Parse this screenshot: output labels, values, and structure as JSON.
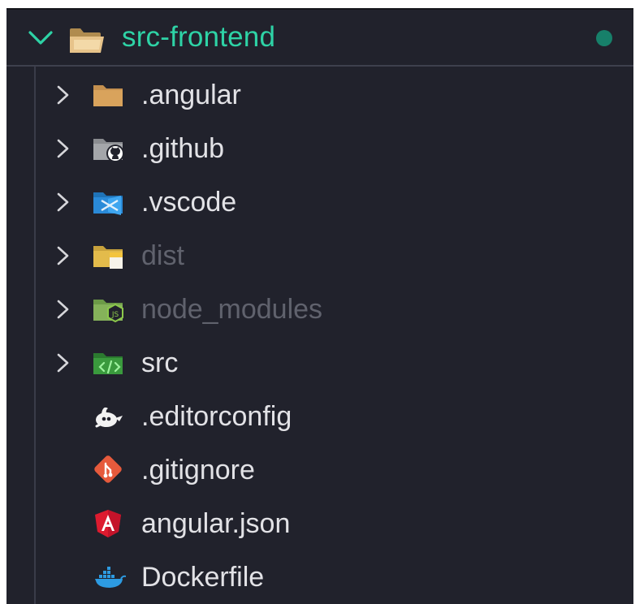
{
  "explorer": {
    "root": {
      "label": "src-frontend",
      "label_color": "#2ed3a6",
      "status_dot_color": "#17806a",
      "icon": "folder-open-icon",
      "expanded": true
    },
    "items": [
      {
        "label": ".angular",
        "type": "folder",
        "icon": "folder-icon",
        "ignored": false
      },
      {
        "label": ".github",
        "type": "folder",
        "icon": "github-folder-icon",
        "ignored": false
      },
      {
        "label": ".vscode",
        "type": "folder",
        "icon": "vscode-folder-icon",
        "ignored": false
      },
      {
        "label": "dist",
        "type": "folder",
        "icon": "dist-folder-icon",
        "ignored": true
      },
      {
        "label": "node_modules",
        "type": "folder",
        "icon": "node-modules-folder-icon",
        "ignored": true
      },
      {
        "label": "src",
        "type": "folder",
        "icon": "src-folder-icon",
        "ignored": false
      },
      {
        "label": ".editorconfig",
        "type": "file",
        "icon": "editorconfig-icon",
        "ignored": false
      },
      {
        "label": ".gitignore",
        "type": "file",
        "icon": "git-icon",
        "ignored": false
      },
      {
        "label": "angular.json",
        "type": "file",
        "icon": "angular-icon",
        "ignored": false
      },
      {
        "label": "Dockerfile",
        "type": "file",
        "icon": "docker-icon",
        "ignored": false
      }
    ]
  }
}
